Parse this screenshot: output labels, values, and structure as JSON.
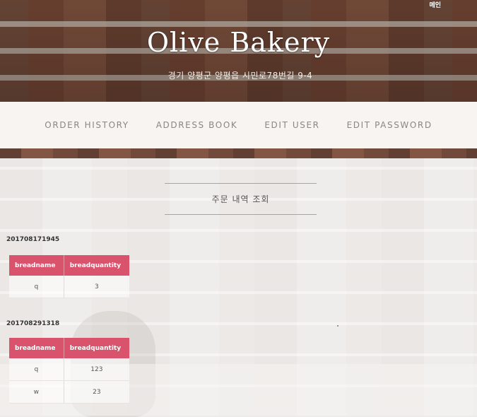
{
  "header": {
    "corner_link": "메인",
    "title": "Olive Bakery",
    "address": "경기 양평군 양평읍 시민로78번길 9-4"
  },
  "nav": {
    "items": [
      {
        "label": "ORDER HISTORY"
      },
      {
        "label": "ADDRESS BOOK"
      },
      {
        "label": "EDIT USER"
      },
      {
        "label": "EDIT PASSWORD"
      }
    ]
  },
  "main": {
    "section_title": "주문 내역 조회",
    "columns": [
      "breadname",
      "breadquantity"
    ],
    "orders": [
      {
        "order_id": "201708171945",
        "rows": [
          {
            "breadname": "q",
            "breadquantity": "3"
          }
        ]
      },
      {
        "order_id": "201708291318",
        "rows": [
          {
            "breadname": "q",
            "breadquantity": "123"
          },
          {
            "breadname": "w",
            "breadquantity": "23"
          }
        ]
      }
    ]
  },
  "colors": {
    "table_header": "#d9536c",
    "nav_text": "#8b8683"
  }
}
